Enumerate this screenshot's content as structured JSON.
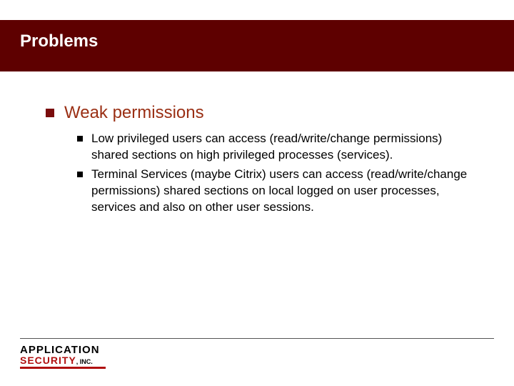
{
  "slide": {
    "title": "Problems",
    "main_bullet": "Weak permissions",
    "sub_bullets": [
      "Low privileged users can access (read/write/change permissions) shared sections on high privileged processes (services).",
      "Terminal Services (maybe Citrix) users can access (read/write/change permissions) shared sections on local logged on user processes, services and also on other user sessions."
    ]
  },
  "logo": {
    "line1": "APPLICATION",
    "line2a": "SECURITY",
    "line2b": ", INC."
  },
  "colors": {
    "header_bg": "#5e0000",
    "accent": "#b01010",
    "bullet_l1_text": "#9a2f14"
  }
}
